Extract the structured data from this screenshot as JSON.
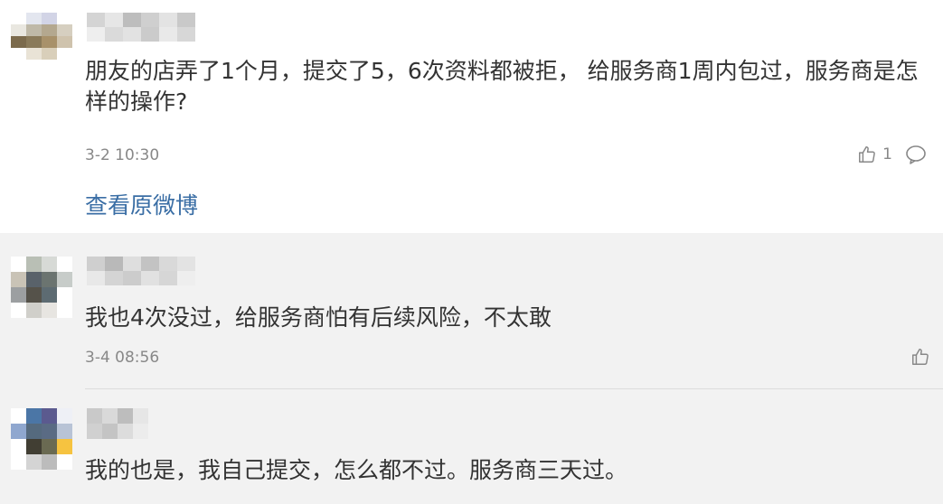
{
  "comments": [
    {
      "text": "朋友的店弄了1个月，提交了5，6次资料都被拒， 给服务商1周内包过，服务商是怎样的操作?",
      "time": "3-2 10:30",
      "likes": "1",
      "link": "查看原微博",
      "avatar_colors": [
        "#ffffff",
        "#e3e6ef",
        "#d2d4e6",
        "#ffffff",
        "#e9e7e0",
        "#bfb9a8",
        "#b4a88f",
        "#d6cfc0",
        "#7b6a4c",
        "#8a7a5a",
        "#a8916a",
        "#cfc3ad",
        "#ffffff",
        "#e9e3d6",
        "#d9cfba",
        "#ffffff"
      ],
      "name_colors": [
        "#d4d4d4",
        "#e6e6e6",
        "#bdbdbd",
        "#cfcfcf",
        "#e3e3e3",
        "#c9c9c9",
        "#eeeeee",
        "#dadada",
        "#e2e2e2",
        "#cbcbcb",
        "#e9e9e9",
        "#d7d7d7"
      ]
    },
    {
      "text": "我也4次没过，给服务商怕有后续风险，不太敢",
      "time": "3-4 08:56",
      "avatar_colors": [
        "#ffffff",
        "#b9bfb5",
        "#d7dad6",
        "#ffffff",
        "#c9c3b6",
        "#59626a",
        "#6b7470",
        "#c7ccc9",
        "#9c9fa1",
        "#55524a",
        "#5d6b72",
        "#ffffff",
        "#ffffff",
        "#d0cfca",
        "#e7e5e1",
        "#ffffff"
      ],
      "name_colors": [
        "#cfcfcf",
        "#b9b9b9",
        "#dedede",
        "#c3c3c3",
        "#d9d9d9",
        "#e3e3e3",
        "#e8e8e8",
        "#d4d4d4",
        "#cccccc",
        "#e1e1e1",
        "#d6d6d6",
        "#eeeeee"
      ]
    },
    {
      "text": "我的也是，我自己提交，怎么都不过。服务商三天过。",
      "avatar_colors": [
        "#ffffff",
        "#4b76a6",
        "#5b5a8f",
        "#eef0f6",
        "#8fa7cf",
        "#556a7e",
        "#5a6b84",
        "#b8c3d6",
        "#ffffff",
        "#413e33",
        "#6a6a52",
        "#f6c340",
        "#ffffff",
        "#d4d4d4",
        "#bcbcbc",
        "#ffffff"
      ],
      "name_colors": [
        "#c9c9c9",
        "#d9d9d9",
        "#bdbdbd",
        "#e6e6e6",
        "#d0d0d0",
        "#c4c4c4",
        "#dcdcdc",
        "#ececec"
      ]
    }
  ]
}
